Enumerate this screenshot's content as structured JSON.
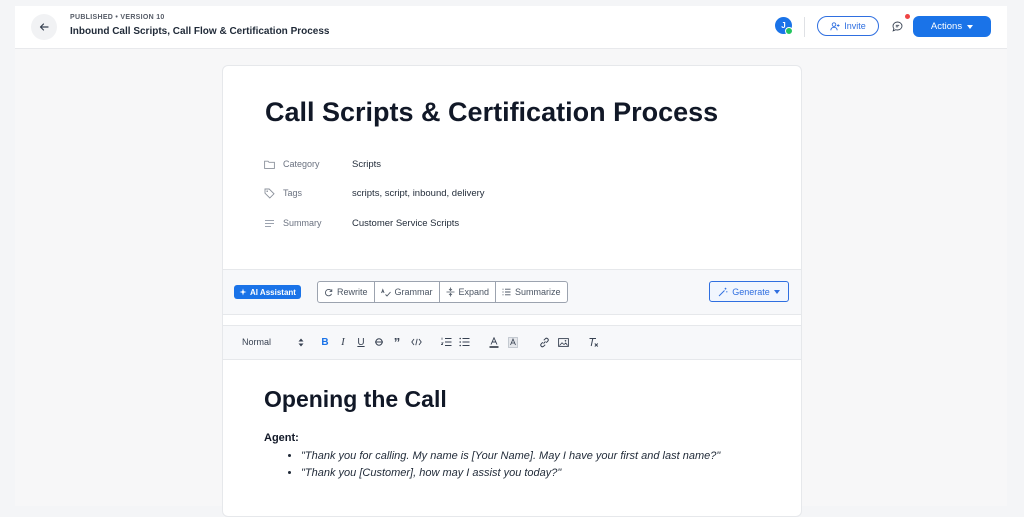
{
  "header": {
    "status_line": "PUBLISHED • VERSION 10",
    "document_title": "Inbound Call Scripts, Call Flow & Certification Process",
    "avatar_initial": "J",
    "invite_label": "Invite",
    "actions_label": "Actions"
  },
  "page": {
    "title": "Call Scripts & Certification Process",
    "properties": [
      {
        "label": "Category",
        "value": "Scripts",
        "icon": "folder-icon"
      },
      {
        "label": "Tags",
        "value": "scripts, script, inbound, delivery",
        "icon": "tag-icon"
      },
      {
        "label": "Summary",
        "value": "Customer Service Scripts",
        "icon": "lines-icon"
      }
    ]
  },
  "ai_toolbar": {
    "assistant_label": "AI Assistant",
    "actions": [
      "Rewrite",
      "Grammar",
      "Expand",
      "Summarize"
    ],
    "generate_label": "Generate"
  },
  "format_toolbar": {
    "heading_value": "Normal",
    "tools": [
      "bold-icon",
      "italic-icon",
      "underline-icon",
      "strikethrough-icon",
      "quote-icon",
      "code-icon",
      "ordered-list-icon",
      "bullet-list-icon",
      "text-color-icon",
      "highlight-icon",
      "link-icon",
      "image-icon",
      "clear-format-icon"
    ]
  },
  "content": {
    "heading": "Opening the Call",
    "speaker": "Agent:",
    "lines": [
      "\"Thank you for calling. My name is [Your Name]. May I have your first and last name?\"",
      "\"Thank you [Customer], how may I assist you today?\""
    ]
  },
  "colors": {
    "accent": "#1a73e8",
    "online": "#22c55e",
    "notification": "#ef4444"
  }
}
